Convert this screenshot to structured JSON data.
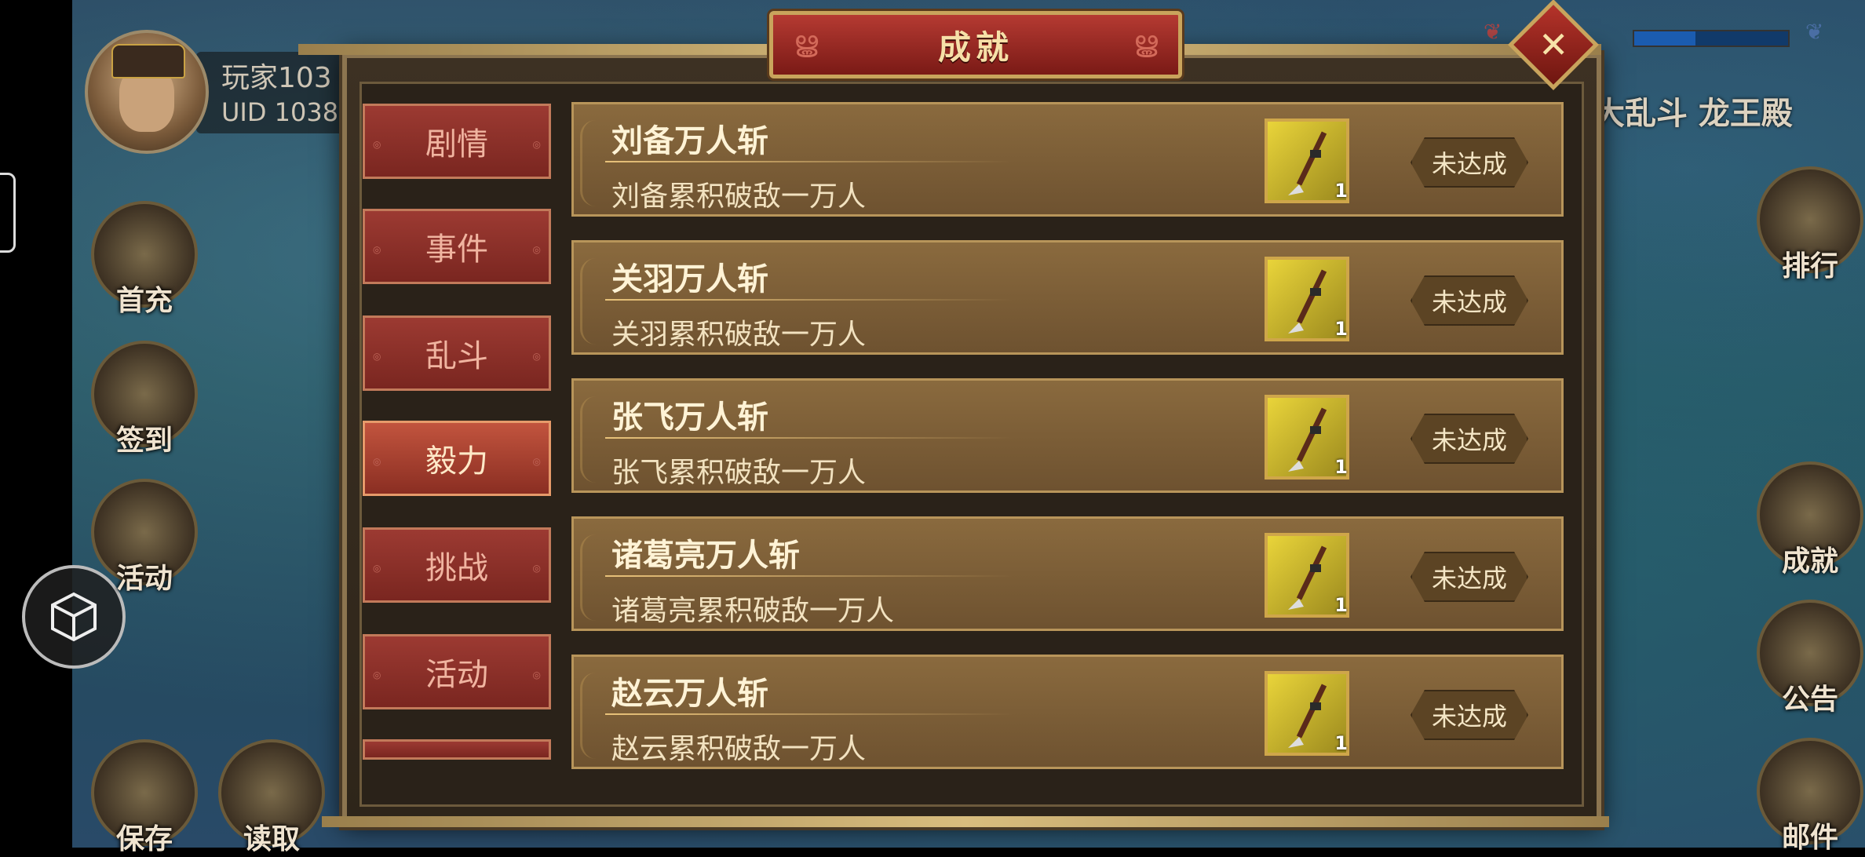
{
  "player": {
    "name": "玩家103",
    "uid": "UID  1038"
  },
  "side_left": [
    {
      "label": "首充",
      "icon": "gift-icon"
    },
    {
      "label": "签到",
      "icon": "checkin-icon"
    },
    {
      "label": "活动",
      "icon": "activity-icon"
    }
  ],
  "bottom_left": [
    {
      "label": "保存",
      "icon": "save-icon"
    },
    {
      "label": "读取",
      "icon": "load-icon"
    }
  ],
  "side_right": [
    {
      "label": "排行",
      "icon": "ranking-icon"
    },
    {
      "label": "成就",
      "icon": "achievement-icon"
    },
    {
      "label": "公告",
      "icon": "notice-icon"
    },
    {
      "label": "邮件",
      "icon": "mail-icon"
    }
  ],
  "top_right_text": "大乱斗 龙王殿",
  "dialog": {
    "title": "成就",
    "close_icon": "close-icon",
    "tabs": [
      {
        "label": "剧情",
        "active": false
      },
      {
        "label": "事件",
        "active": false
      },
      {
        "label": "乱斗",
        "active": false
      },
      {
        "label": "毅力",
        "active": true
      },
      {
        "label": "挑战",
        "active": false
      },
      {
        "label": "活动",
        "active": false
      }
    ],
    "achievements": [
      {
        "title": "刘备万人斩",
        "desc": "刘备累积破敌一万人",
        "reward_count": "1",
        "status": "未达成"
      },
      {
        "title": "关羽万人斩",
        "desc": "关羽累积破敌一万人",
        "reward_count": "1",
        "status": "未达成"
      },
      {
        "title": "张飞万人斩",
        "desc": "张飞累积破敌一万人",
        "reward_count": "1",
        "status": "未达成"
      },
      {
        "title": "诸葛亮万人斩",
        "desc": "诸葛亮累积破敌一万人",
        "reward_count": "1",
        "status": "未达成"
      },
      {
        "title": "赵云万人斩",
        "desc": "赵云累积破敌一万人",
        "reward_count": "1",
        "status": "未达成"
      }
    ]
  },
  "colors": {
    "accent_red": "#9c3a32",
    "gold": "#c9a45c",
    "row_bg": "#8a6a3e"
  }
}
